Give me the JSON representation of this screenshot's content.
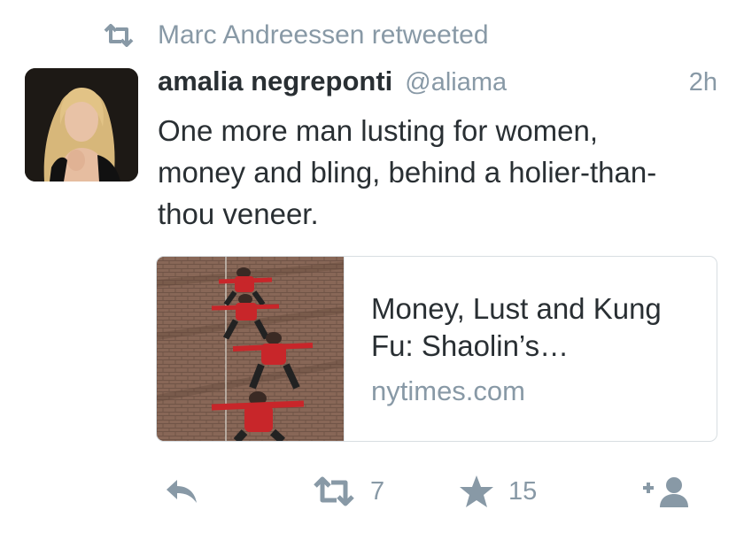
{
  "retweet_context": {
    "icon": "retweet-icon",
    "text": "Marc Andreessen retweeted"
  },
  "author": {
    "display_name": "amalia negreponti",
    "handle": "@aliama",
    "avatar_icon": "avatar-photo"
  },
  "time": "2h",
  "text": "One more man lusting for women, money and bling, behind a holier-than-thou veneer.",
  "card": {
    "title": "Money, Lust and Kung Fu: Shaolin’s…",
    "domain": "nytimes.com",
    "image_icon": "kung-fu-practitioners-image"
  },
  "actions": {
    "reply_icon": "reply-icon",
    "retweet_icon": "retweet-icon",
    "retweet_count": "7",
    "favorite_icon": "star-icon",
    "favorite_count": "15",
    "follow_icon": "add-user-icon"
  },
  "colors": {
    "text": "#292f33",
    "muted": "#8899a6",
    "card_border": "#d8dee2"
  }
}
